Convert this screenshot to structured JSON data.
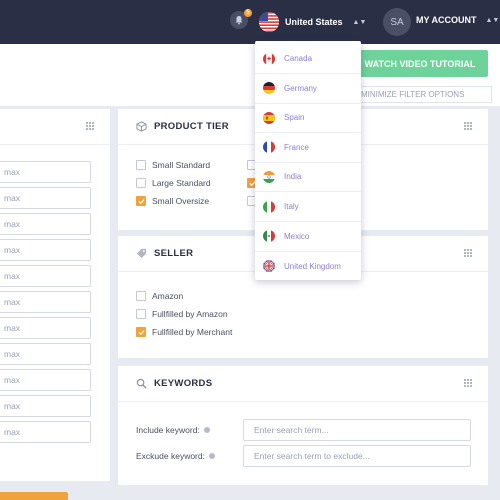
{
  "header": {
    "notification_count": "5",
    "country": "United States",
    "avatar_initials": "SA",
    "account_label": "MY ACCOUNT"
  },
  "toolbar": {
    "watch_video": "WATCH VIDEO TUTORIAL",
    "minimize_filters": "MINIMIZE FILTER OPTIONS"
  },
  "left_panel": {
    "max_placeholder": "max"
  },
  "product_tier": {
    "title": "PRODUCT TIER",
    "options": [
      {
        "label": "Small Standard",
        "checked": false
      },
      {
        "label": "Large Standard",
        "checked": false
      },
      {
        "label": "Small Oversize",
        "checked": true
      }
    ]
  },
  "seller": {
    "title": "SELLER",
    "options": [
      {
        "label": "Amazon",
        "checked": false
      },
      {
        "label": "Fullfilled by Amazon",
        "checked": false
      },
      {
        "label": "Fullfilled by Merchant",
        "checked": true
      }
    ]
  },
  "keywords": {
    "title": "KEYWORDS",
    "include_label": "Include keyword:",
    "include_placeholder": "Enter search term...",
    "exclude_label": "Exckude keyword:",
    "exclude_placeholder": "Enter search term to exclude..."
  },
  "country_dropdown": {
    "items": [
      "Canada",
      "Germany",
      "Spain",
      "France",
      "India",
      "Italy",
      "Mexico",
      "United Kingdom"
    ]
  },
  "colors": {
    "topbar": "#2b2f45",
    "accent_orange": "#f0a23c",
    "accent_green": "#6dd39a",
    "dropdown_text": "#8a7fd0"
  }
}
